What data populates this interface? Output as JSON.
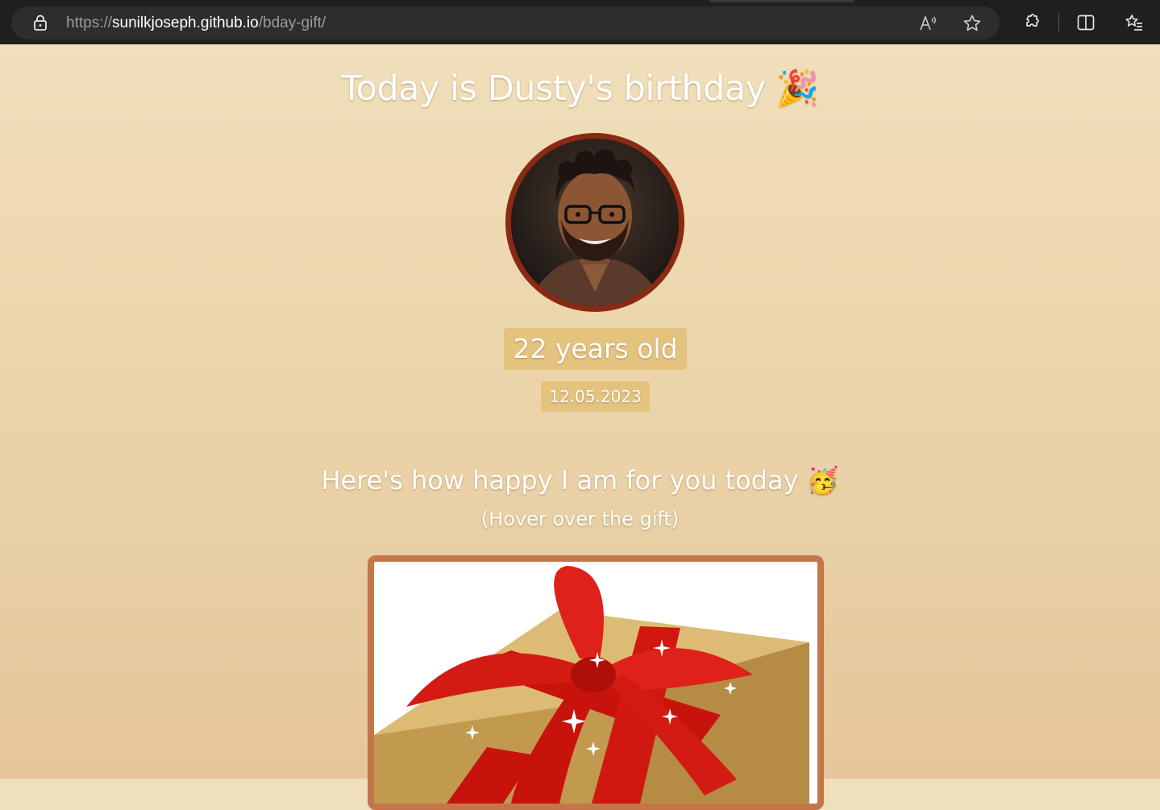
{
  "browser": {
    "url_scheme": "https://",
    "url_host": "sunilkjoseph.github.io",
    "url_path": "/bday-gift/",
    "icons": [
      "lock-icon",
      "read-aloud-icon",
      "favorite-star-icon",
      "extensions-icon",
      "split-screen-icon",
      "favorites-list-icon"
    ]
  },
  "page": {
    "title": "Today is Dusty's birthday 🎉",
    "age_label": "22 years old",
    "date_label": "12.05.2023",
    "subtitle": "Here's how happy I am for you today 🥳",
    "hint": "(Hover over the gift)"
  },
  "colors": {
    "background_top": "#f0dfbb",
    "background_bottom": "#e5c69a",
    "badge": "#e4c37f",
    "avatar_border": "#8a2a13",
    "gift_frame": "#c4764a",
    "ribbon": "#d81a12",
    "box": "#d8b466"
  }
}
